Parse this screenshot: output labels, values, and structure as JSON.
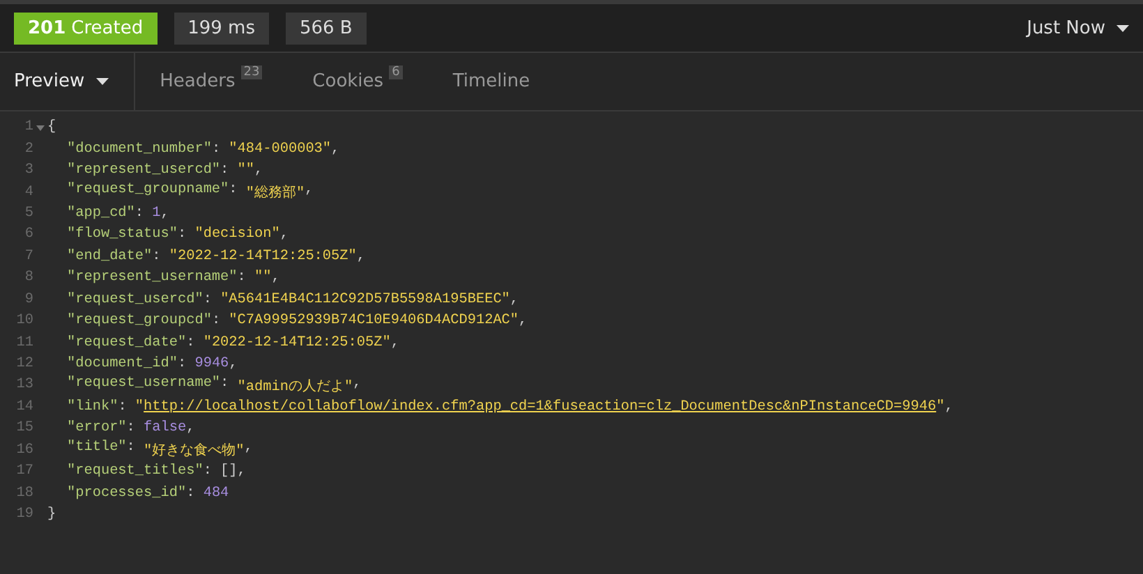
{
  "response_bar": {
    "status": {
      "code": "201",
      "text": "Created",
      "color": "#75ba24"
    },
    "time": "199 ms",
    "size": "566 B",
    "history": "Just Now"
  },
  "tabs": [
    {
      "label": "Preview",
      "selected": true,
      "dropdown": true
    },
    {
      "label": "Headers",
      "count": "23",
      "selected": false
    },
    {
      "label": "Cookies",
      "count": "6",
      "selected": false
    },
    {
      "label": "Timeline",
      "selected": false
    }
  ],
  "lines": [
    {
      "number": "1",
      "expanded": true,
      "tokens": [
        {
          "kind": "punct",
          "text": "{"
        }
      ]
    },
    {
      "number": "2",
      "tokens": [
        {
          "kind": "key",
          "text": "\"document_number\""
        },
        {
          "kind": "punct",
          "text": ": "
        },
        {
          "kind": "string",
          "text": "\"484-000003\""
        },
        {
          "kind": "punct",
          "text": ","
        }
      ]
    },
    {
      "number": "3",
      "tokens": [
        {
          "kind": "key",
          "text": "\"represent_usercd\""
        },
        {
          "kind": "punct",
          "text": ": "
        },
        {
          "kind": "string",
          "text": "\"\""
        },
        {
          "kind": "punct",
          "text": ","
        }
      ]
    },
    {
      "number": "4",
      "tokens": [
        {
          "kind": "key",
          "text": "\"request_groupname\""
        },
        {
          "kind": "punct",
          "text": ": "
        },
        {
          "kind": "string",
          "text": "\"総務部\""
        },
        {
          "kind": "punct",
          "text": ","
        }
      ]
    },
    {
      "number": "5",
      "tokens": [
        {
          "kind": "key",
          "text": "\"app_cd\""
        },
        {
          "kind": "punct",
          "text": ": "
        },
        {
          "kind": "number",
          "text": "1"
        },
        {
          "kind": "punct",
          "text": ","
        }
      ]
    },
    {
      "number": "6",
      "tokens": [
        {
          "kind": "key",
          "text": "\"flow_status\""
        },
        {
          "kind": "punct",
          "text": ": "
        },
        {
          "kind": "string",
          "text": "\"decision\""
        },
        {
          "kind": "punct",
          "text": ","
        }
      ]
    },
    {
      "number": "7",
      "tokens": [
        {
          "kind": "key",
          "text": "\"end_date\""
        },
        {
          "kind": "punct",
          "text": ": "
        },
        {
          "kind": "string",
          "text": "\"2022-12-14T12:25:05Z\""
        },
        {
          "kind": "punct",
          "text": ","
        }
      ]
    },
    {
      "number": "8",
      "tokens": [
        {
          "kind": "key",
          "text": "\"represent_username\""
        },
        {
          "kind": "punct",
          "text": ": "
        },
        {
          "kind": "string",
          "text": "\"\""
        },
        {
          "kind": "punct",
          "text": ","
        }
      ]
    },
    {
      "number": "9",
      "tokens": [
        {
          "kind": "key",
          "text": "\"request_usercd\""
        },
        {
          "kind": "punct",
          "text": ": "
        },
        {
          "kind": "string",
          "text": "\"A5641E4B4C112C92D57B5598A195BEEC\""
        },
        {
          "kind": "punct",
          "text": ","
        }
      ]
    },
    {
      "number": "10",
      "tokens": [
        {
          "kind": "key",
          "text": "\"request_groupcd\""
        },
        {
          "kind": "punct",
          "text": ": "
        },
        {
          "kind": "string",
          "text": "\"C7A99952939B74C10E9406D4ACD912AC\""
        },
        {
          "kind": "punct",
          "text": ","
        }
      ]
    },
    {
      "number": "11",
      "tokens": [
        {
          "kind": "key",
          "text": "\"request_date\""
        },
        {
          "kind": "punct",
          "text": ": "
        },
        {
          "kind": "string",
          "text": "\"2022-12-14T12:25:05Z\""
        },
        {
          "kind": "punct",
          "text": ","
        }
      ]
    },
    {
      "number": "12",
      "tokens": [
        {
          "kind": "key",
          "text": "\"document_id\""
        },
        {
          "kind": "punct",
          "text": ": "
        },
        {
          "kind": "number",
          "text": "9946"
        },
        {
          "kind": "punct",
          "text": ","
        }
      ]
    },
    {
      "number": "13",
      "tokens": [
        {
          "kind": "key",
          "text": "\"request_username\""
        },
        {
          "kind": "punct",
          "text": ": "
        },
        {
          "kind": "string",
          "text": "\"adminの人だよ\""
        },
        {
          "kind": "punct",
          "text": ","
        }
      ]
    },
    {
      "number": "14",
      "tokens": [
        {
          "kind": "key",
          "text": "\"link\""
        },
        {
          "kind": "punct",
          "text": ": "
        },
        {
          "kind": "string",
          "text": "\""
        },
        {
          "kind": "link",
          "text": "http://localhost/collaboflow/index.cfm?app_cd=1&fuseaction=clz_DocumentDesc&nPInstanceCD=9946"
        },
        {
          "kind": "string",
          "text": "\""
        },
        {
          "kind": "punct",
          "text": ","
        }
      ]
    },
    {
      "number": "15",
      "tokens": [
        {
          "kind": "key",
          "text": "\"error\""
        },
        {
          "kind": "punct",
          "text": ": "
        },
        {
          "kind": "number",
          "text": "false"
        },
        {
          "kind": "punct",
          "text": ","
        }
      ]
    },
    {
      "number": "16",
      "tokens": [
        {
          "kind": "key",
          "text": "\"title\""
        },
        {
          "kind": "punct",
          "text": ": "
        },
        {
          "kind": "string",
          "text": "\"好きな食べ物\""
        },
        {
          "kind": "punct",
          "text": ","
        }
      ]
    },
    {
      "number": "17",
      "tokens": [
        {
          "kind": "key",
          "text": "\"request_titles\""
        },
        {
          "kind": "punct",
          "text": ": []"
        },
        {
          "kind": "punct",
          "text": ","
        }
      ]
    },
    {
      "number": "18",
      "tokens": [
        {
          "kind": "key",
          "text": "\"processes_id\""
        },
        {
          "kind": "punct",
          "text": ": "
        },
        {
          "kind": "number",
          "text": "484"
        }
      ]
    },
    {
      "number": "19",
      "tokens": [
        {
          "kind": "punct",
          "text": "}"
        }
      ]
    }
  ]
}
